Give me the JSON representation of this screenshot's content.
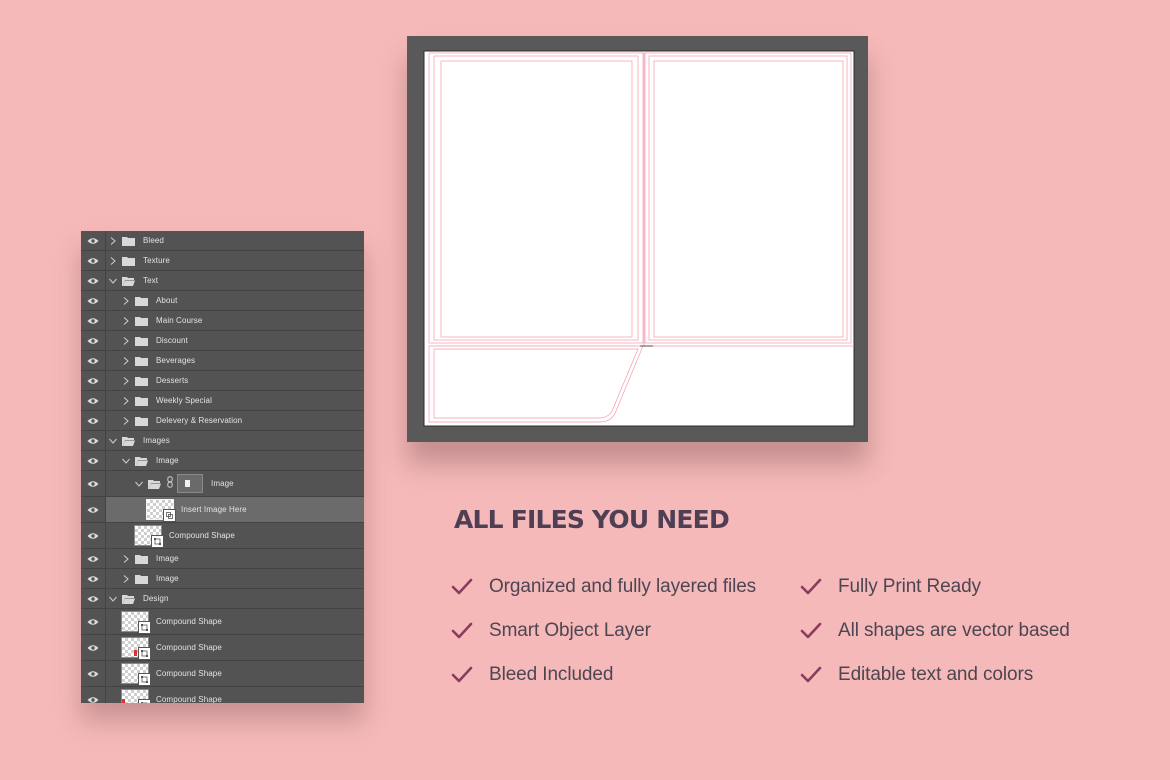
{
  "layers_panel": {
    "rows": [
      {
        "label": "Bleed"
      },
      {
        "label": "Texture"
      },
      {
        "label": "Text"
      },
      {
        "label": "About"
      },
      {
        "label": "Main Course"
      },
      {
        "label": "Discount"
      },
      {
        "label": "Beverages"
      },
      {
        "label": "Desserts"
      },
      {
        "label": "Weekly Special"
      },
      {
        "label": "Delevery & Reservation"
      },
      {
        "label": "Images"
      },
      {
        "label": "Image"
      },
      {
        "label": "Image"
      },
      {
        "label": "Insert Image Here"
      },
      {
        "label": "Compound Shape"
      },
      {
        "label": "Image"
      },
      {
        "label": "Image"
      },
      {
        "label": "Design"
      },
      {
        "label": "Compound Shape"
      },
      {
        "label": "Compound Shape"
      },
      {
        "label": "Compound Shape"
      },
      {
        "label": "Compound Shape"
      }
    ]
  },
  "features": {
    "title": "ALL FILES YOU NEED",
    "items": [
      {
        "label": "Organized and fully layered files"
      },
      {
        "label": "Fully Print Ready"
      },
      {
        "label": "Smart Object Layer"
      },
      {
        "label": "All shapes are vector based"
      },
      {
        "label": "Bleed Included"
      },
      {
        "label": "Editable text and colors"
      }
    ]
  },
  "colors": {
    "background": "#f5b9b9",
    "panel": "#535353",
    "accent_check": "#8b3b5f",
    "title_text": "#4e3f55",
    "guide_lines": "#f29aa9"
  },
  "icons": {
    "eye": "eye-icon",
    "folder": "folder-icon",
    "chevron_right": "chevron-right-icon",
    "chevron_down": "chevron-down-icon",
    "link": "link-icon",
    "check": "check-icon"
  }
}
